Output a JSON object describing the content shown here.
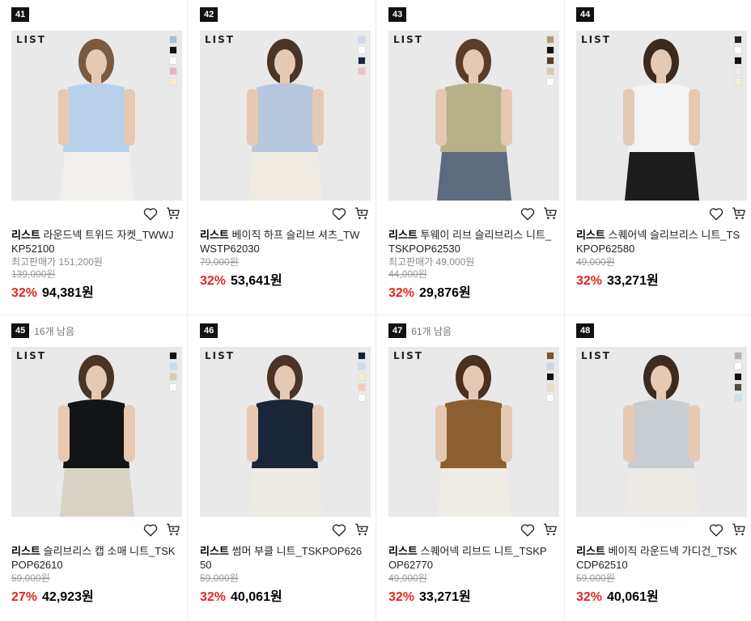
{
  "products": [
    {
      "rank": "41",
      "stock": "",
      "brand_mark": "LIST",
      "swatches": [
        "#aebdd3",
        "#111111",
        "#ffffff",
        "#e5b5c3",
        "#f7edc8"
      ],
      "brand": "리스트",
      "name": "라운드넥 트위드 자켓_TWWJKP52100",
      "max_price": "최고판매가 151,200원",
      "orig_price": "139,000원",
      "discount": "32%",
      "price": "94,381원",
      "top": "#b9d0ea",
      "bottom": "#f2f0ec",
      "hair": "#7a5a40"
    },
    {
      "rank": "42",
      "stock": "",
      "brand_mark": "LIST",
      "swatches": [
        "#cdd9ec",
        "#ffffff",
        "#1b2742",
        "#f2c1c1"
      ],
      "brand": "리스트",
      "name": "베이직 하프 슬리브 셔츠_TWWSTP62030",
      "max_price": "",
      "orig_price": "79,000원",
      "discount": "32%",
      "price": "53,641원",
      "top": "#b8c6de",
      "bottom": "#f0ece4",
      "hair": "#4a3426"
    },
    {
      "rank": "43",
      "stock": "",
      "brand_mark": "LIST",
      "swatches": [
        "#b09a72",
        "#111111",
        "#5a3f2b",
        "#d8cbb0",
        "#ffffff"
      ],
      "brand": "리스트",
      "name": "투웨이 리브 슬리브리스 니트_TSKPOP62530",
      "max_price": "최고판매가 49,000원",
      "orig_price": "44,000원",
      "discount": "32%",
      "price": "29,876원",
      "top": "#b7b18a",
      "bottom": "#5e6a7d",
      "hair": "#5a3d28"
    },
    {
      "rank": "44",
      "stock": "",
      "brand_mark": "LIST",
      "swatches": [
        "#222222",
        "#ffffff",
        "#111111",
        "#eeeeee",
        "#f3efd2"
      ],
      "brand": "리스트",
      "name": "스퀘어넥 슬리브리스 니트_TSKPOP62580",
      "max_price": "",
      "orig_price": "49,000원",
      "discount": "32%",
      "price": "33,271원",
      "top": "#f4f4f4",
      "bottom": "#1d1d1d",
      "hair": "#3b2a1d"
    },
    {
      "rank": "45",
      "stock": "16개 남음",
      "brand_mark": "LIST",
      "swatches": [
        "#111111",
        "#c9daee",
        "#d5ccb5",
        "#ffffff"
      ],
      "brand": "리스트",
      "name": "슬리브리스 캡 소매 니트_TSKPOP62610",
      "max_price": "",
      "orig_price": "59,000원",
      "discount": "27%",
      "price": "42,923원",
      "top": "#121416",
      "bottom": "#d9d3c6",
      "hair": "#4a3424"
    },
    {
      "rank": "46",
      "stock": "",
      "brand_mark": "LIST",
      "swatches": [
        "#14203a",
        "#cddcee",
        "#f5ecc8",
        "#f1cdb9",
        "#ffffff"
      ],
      "brand": "리스트",
      "name": "썸머 부클 니트_TSKPOP62650",
      "max_price": "",
      "orig_price": "59,000원",
      "discount": "32%",
      "price": "40,061원",
      "top": "#1a2638",
      "bottom": "#eeebe4",
      "hair": "#4a3426"
    },
    {
      "rank": "47",
      "stock": "61개 남음",
      "brand_mark": "LIST",
      "swatches": [
        "#7b5330",
        "#c8d9ee",
        "#111111",
        "#eadfc6",
        "#ffffff"
      ],
      "brand": "리스트",
      "name": "스퀘어넥 리브드 니트_TSKPOP62770",
      "max_price": "",
      "orig_price": "49,000원",
      "discount": "32%",
      "price": "33,271원",
      "top": "#8a6030",
      "bottom": "#efece5",
      "hair": "#4a3020"
    },
    {
      "rank": "48",
      "stock": "",
      "brand_mark": "LIST",
      "swatches": [
        "#b4b4b4",
        "#ffffff",
        "#111111",
        "#4a4e44",
        "#cfe0f2"
      ],
      "brand": "리스트",
      "name": "베이직 라운드넥 가디건_TSKCDP62510",
      "max_price": "",
      "orig_price": "59,000원",
      "discount": "32%",
      "price": "40,061원",
      "top": "#c8cdd2",
      "bottom": "#eeebe6",
      "hair": "#3c2c20"
    }
  ]
}
